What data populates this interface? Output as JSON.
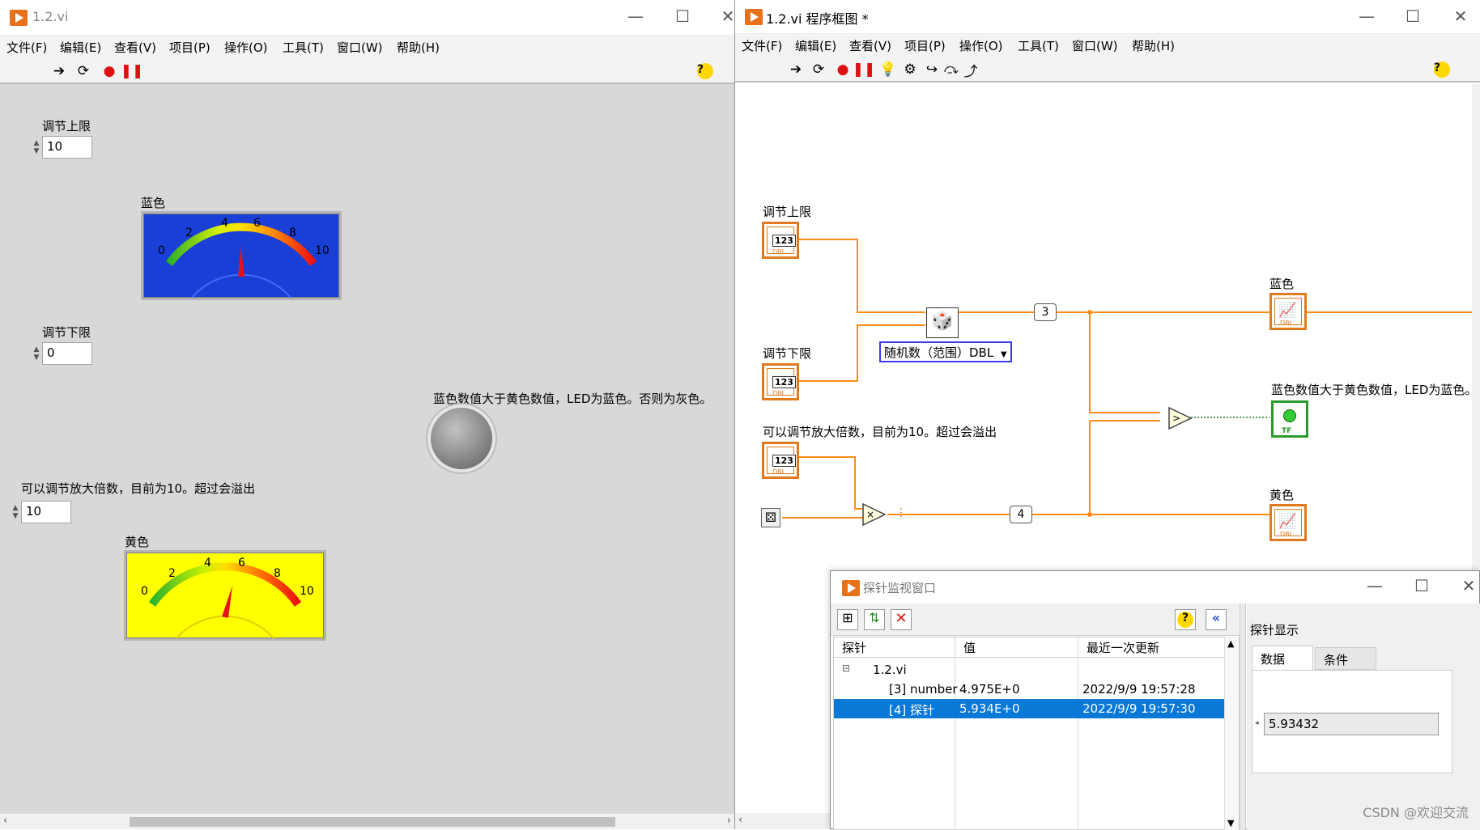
{
  "front_panel": {
    "title": "1.2.vi",
    "menus": [
      "文件(F)",
      "编辑(E)",
      "查看(V)",
      "项目(P)",
      "操作(O)",
      "工具(T)",
      "窗口(W)",
      "帮助(H)"
    ],
    "controls": {
      "upper_label": "调节上限",
      "upper_value": "10",
      "lower_label": "调节下限",
      "lower_value": "0",
      "mult_label": "可以调节放大倍数，目前为10。超过会溢出",
      "mult_value": "10"
    },
    "meter_blue": {
      "label": "蓝色",
      "ticks": [
        "0",
        "2",
        "4",
        "6",
        "8",
        "10"
      ],
      "value": 4.975,
      "bg": "#1a3fd6"
    },
    "meter_yellow": {
      "label": "黄色",
      "ticks": [
        "0",
        "2",
        "4",
        "6",
        "8",
        "10"
      ],
      "value": 5.934,
      "bg": "#ffff00"
    },
    "led": {
      "label": "蓝色数值大于黄色数值，LED为蓝色。否则为灰色。"
    }
  },
  "block_diagram": {
    "title": "1.2.vi 程序框图 *",
    "menus": [
      "文件(F)",
      "编辑(E)",
      "查看(V)",
      "项目(P)",
      "操作(O)",
      "工具(T)",
      "窗口(W)",
      "帮助(H)"
    ],
    "terminals": {
      "upper": "调节上限",
      "lower": "调节下限",
      "mult": "可以调节放大倍数，目前为10。超过会溢出",
      "blue": "蓝色",
      "led": "蓝色数值大于黄色数值，LED为蓝色。",
      "yellow": "黄色",
      "term_text": "123",
      "term_type": "DBL",
      "bool_type": "TF"
    },
    "random_dropdown": "随机数（范围）DBL",
    "probe3": "3",
    "probe4": "4"
  },
  "probe_window": {
    "title": "探针监视窗口",
    "side_title": "探针显示",
    "tabs": [
      "数据",
      "条件"
    ],
    "columns": [
      "探针",
      "值",
      "最近一次更新"
    ],
    "vi_name": "1.2.vi",
    "rows": [
      {
        "name": "[3] number",
        "value": "4.975E+0",
        "time": "2022/9/9 19:57:28"
      },
      {
        "name": "[4] 探针",
        "value": "5.934E+0",
        "time": "2022/9/9 19:57:30"
      }
    ],
    "display_value": "5.93432"
  },
  "watermark": "CSDN @欢迎交流"
}
